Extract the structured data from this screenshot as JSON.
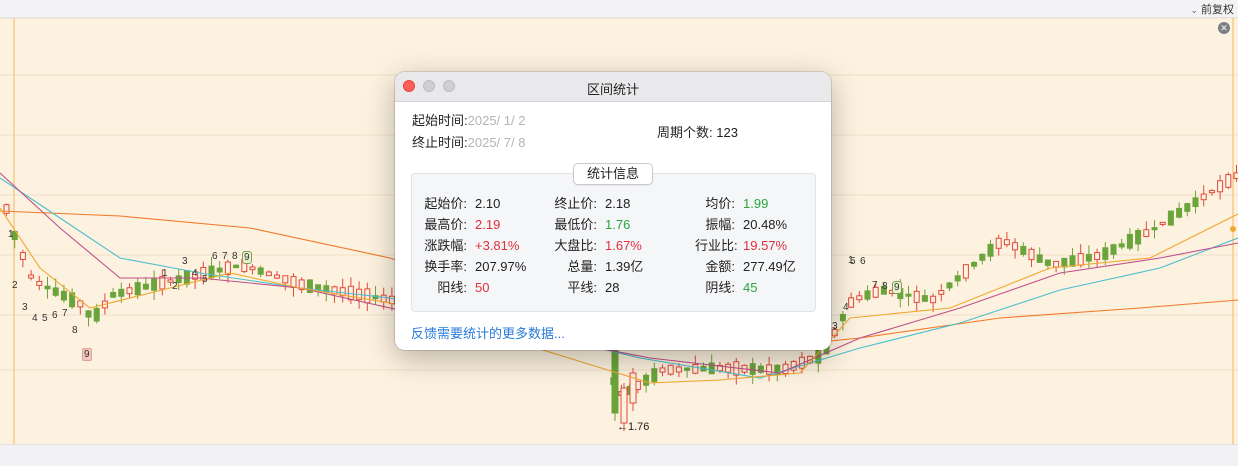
{
  "toolbar": {
    "adjust_label": "前复权"
  },
  "chart_overlay": {
    "low_label": "←1.76",
    "wave_marks": [
      "1",
      "2",
      "3",
      "4",
      "5",
      "6",
      "7",
      "8",
      "9",
      "1",
      "2",
      "3",
      "4",
      "5",
      "6",
      "7",
      "8",
      "9",
      "1",
      "3",
      "4",
      "5",
      "6",
      "7",
      "8",
      "9"
    ]
  },
  "dialog": {
    "title": "区间统计",
    "start_label": "起始时间:",
    "start_value": "2025/  1/  2",
    "end_label": "终止时间:",
    "end_value": "2025/  7/  8",
    "period_label": "周期个数:",
    "period_value": "123",
    "section_button": "统计信息",
    "stats": [
      {
        "key": "起始价:",
        "value": "2.10",
        "color": "dark"
      },
      {
        "key": "终止价:",
        "value": "2.18",
        "color": "dark"
      },
      {
        "key": "均价:",
        "value": "1.99",
        "color": "green"
      },
      {
        "key": "最高价:",
        "value": "2.19",
        "color": "red"
      },
      {
        "key": "最低价:",
        "value": "1.76",
        "color": "green"
      },
      {
        "key": "振幅:",
        "value": "20.48%",
        "color": "dark"
      },
      {
        "key": "涨跌幅:",
        "value": "+3.81%",
        "color": "red"
      },
      {
        "key": "大盘比:",
        "value": "1.67%",
        "color": "red"
      },
      {
        "key": "行业比:",
        "value": "19.57%",
        "color": "red"
      },
      {
        "key": "换手率:",
        "value": "207.97%",
        "color": "dark"
      },
      {
        "key": "总量:",
        "value": "1.39亿",
        "color": "dark"
      },
      {
        "key": "金额:",
        "value": "277.49亿",
        "color": "dark"
      },
      {
        "key": "阳线:",
        "value": "50",
        "color": "red"
      },
      {
        "key": "平线:",
        "value": "28",
        "color": "dark"
      },
      {
        "key": "阴线:",
        "value": "45",
        "color": "green"
      }
    ],
    "feedback_link": "反馈需要统计的更多数据..."
  }
}
